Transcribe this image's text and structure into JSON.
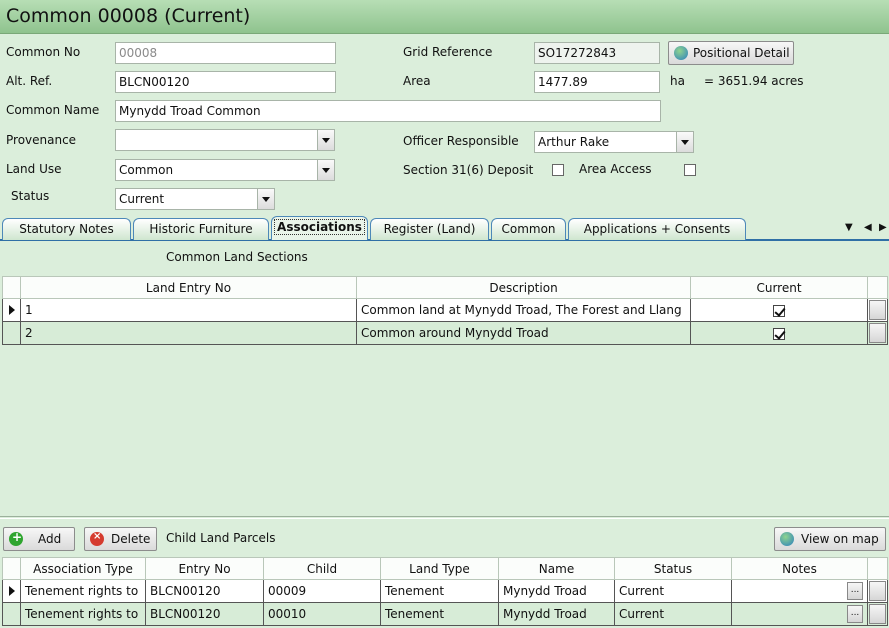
{
  "window": {
    "title": "Common 00008 (Current)"
  },
  "form": {
    "common_no_label": "Common No",
    "common_no_value": "00008",
    "alt_ref_label": "Alt. Ref.",
    "alt_ref_value": "BLCN00120",
    "common_name_label": "Common Name",
    "common_name_value": "Mynydd Troad Common",
    "provenance_label": "Provenance",
    "provenance_value": "",
    "land_use_label": "Land Use",
    "land_use_value": "Common",
    "status_label": "Status",
    "status_value": "Current",
    "grid_ref_label": "Grid Reference",
    "grid_ref_value": "SO17272843",
    "positional_detail_button": "Positional Detail",
    "area_label": "Area",
    "area_value": "1477.89",
    "area_unit": "ha",
    "area_acres": "= 3651.94 acres",
    "officer_label": "Officer Responsible",
    "officer_value": "Arthur Rake",
    "section_label": "Section 31(6) Deposit",
    "area_access_label": "Area Access"
  },
  "tabs": [
    {
      "label": "Statutory Notes"
    },
    {
      "label": "Historic Furniture"
    },
    {
      "label": "Associations"
    },
    {
      "label": "Register (Land)"
    },
    {
      "label": "Common"
    },
    {
      "label": "Applications + Consents"
    }
  ],
  "sections": {
    "title": "Common Land Sections",
    "headers": [
      "Land Entry No",
      "Description",
      "Current"
    ],
    "rows": [
      {
        "entry": "1",
        "description": "Common land at Mynydd Troad, The Forest and Llang",
        "current": true
      },
      {
        "entry": "2",
        "description": "Common around Mynydd Troad",
        "current": true
      }
    ]
  },
  "parcels": {
    "add_button": "Add",
    "delete_button": "Delete",
    "title": "Child Land Parcels",
    "view_on_map_button": "View on map",
    "headers": [
      "Association Type",
      "Entry No",
      "Child",
      "Land Type",
      "Name",
      "Status",
      "Notes"
    ],
    "rows": [
      {
        "assoc": "Tenement rights to",
        "entry": "BLCN00120",
        "child": "00009",
        "land_type": "Tenement",
        "name": "Mynydd Troad",
        "status": "Current",
        "notes": ""
      },
      {
        "assoc": "Tenement rights to",
        "entry": "BLCN00120",
        "child": "00010",
        "land_type": "Tenement",
        "name": "Mynydd Troad",
        "status": "Current",
        "notes": ""
      }
    ]
  },
  "colors": {
    "background": "#dbeedb",
    "tab_border": "#2f6fa6",
    "titlebar": "#9fcf9e"
  }
}
